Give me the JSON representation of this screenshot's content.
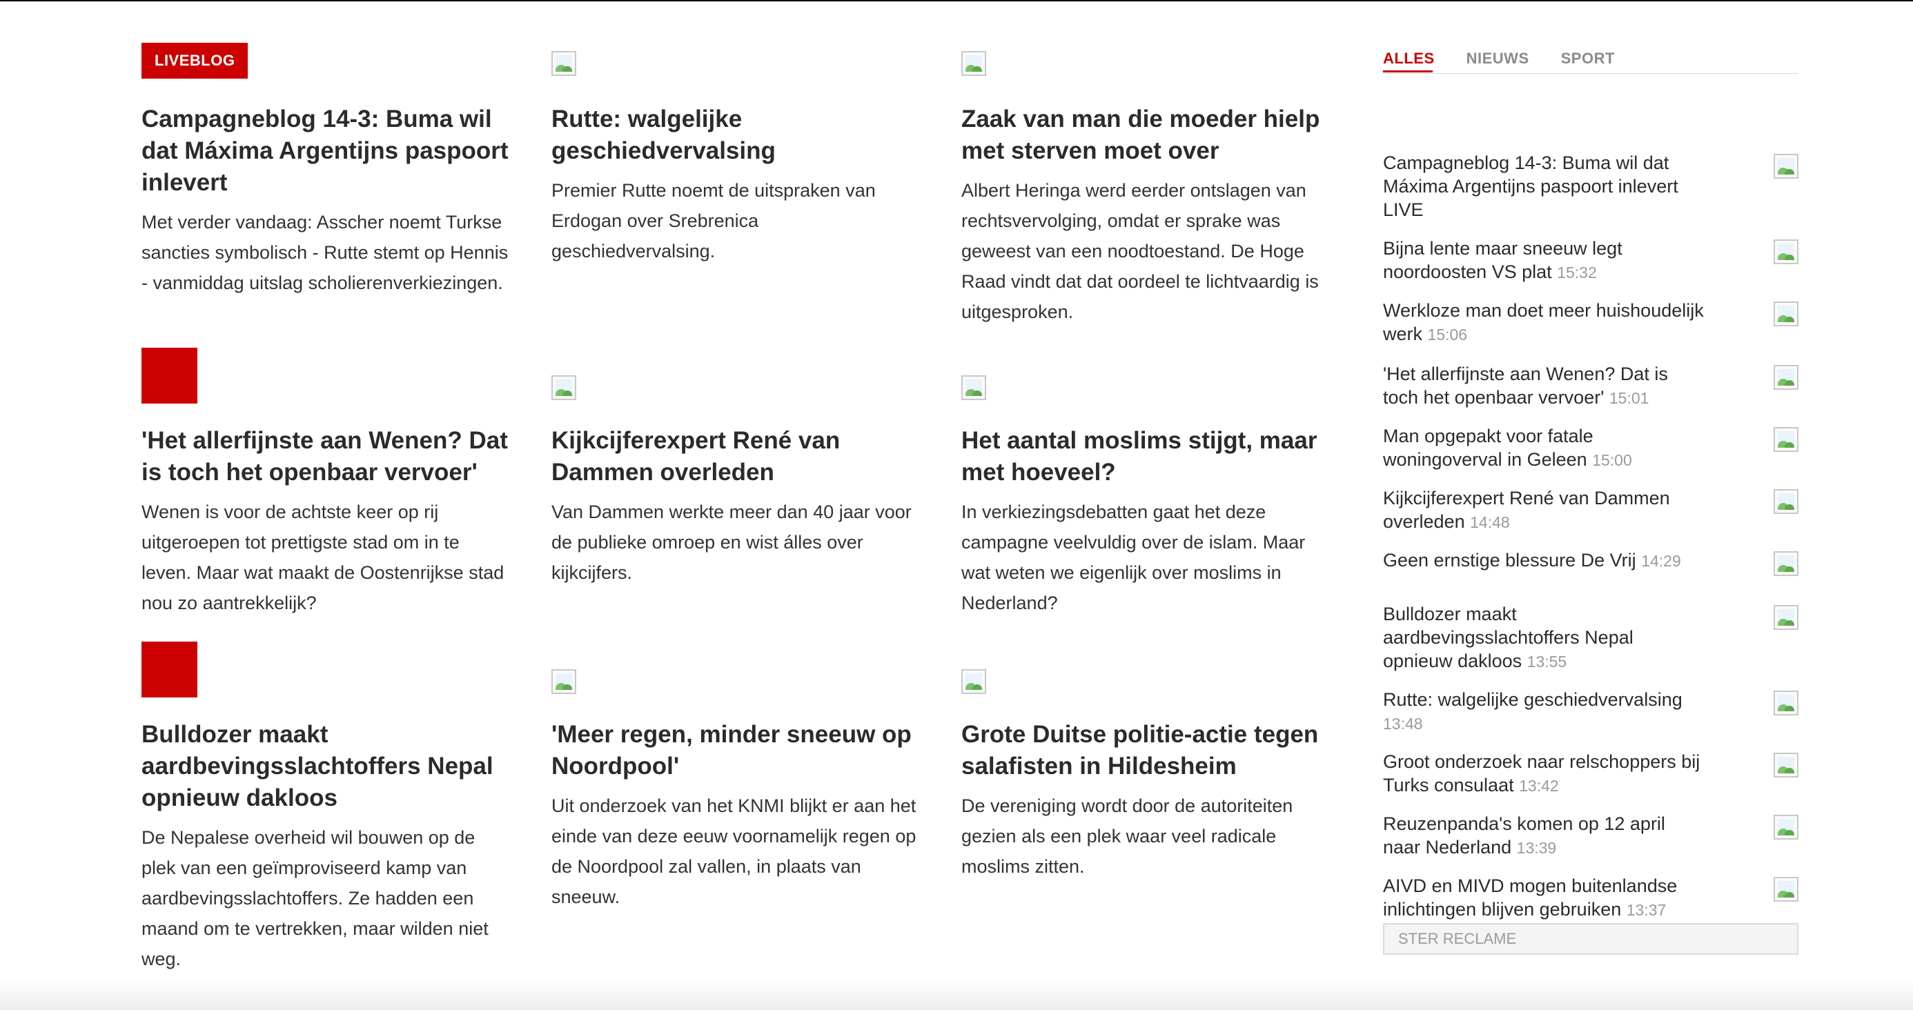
{
  "badge": {
    "label": "LIVEBLOG"
  },
  "articles": [
    {
      "title": "Campagneblog 14-3: Buma wil dat Máxima Argentijns paspoort inlevert",
      "excerpt": "Met verder vandaag: Asscher noemt Turkse sancties symbolisch - Rutte stemt op Hennis - vanmiddag uitslag scholierenverkiezingen."
    },
    {
      "title": "Rutte: walgelijke geschiedvervalsing",
      "excerpt": "Premier Rutte noemt de uitspraken van Erdogan over Srebrenica geschiedvervalsing."
    },
    {
      "title": "Zaak van man die moeder hielp met sterven moet over",
      "excerpt": "Albert Heringa werd eerder ontslagen van rechtsvervolging, omdat er sprake was geweest van een noodtoestand. De Hoge Raad vindt dat dat oordeel te lichtvaardig is uitgesproken."
    },
    {
      "title": "'Het allerfijnste aan Wenen? Dat is toch het openbaar vervoer'",
      "excerpt": "Wenen is voor de achtste keer op rij uitgeroepen tot prettigste stad om in te leven. Maar wat maakt de Oostenrijkse stad nou zo aantrekkelijk?"
    },
    {
      "title": "Kijkcijferexpert René van Dammen overleden",
      "excerpt": "Van Dammen werkte meer dan 40 jaar voor de publieke omroep en wist álles over kijkcijfers."
    },
    {
      "title": "Het aantal moslims stijgt, maar met hoeveel?",
      "excerpt": "In verkiezingsdebatten gaat het deze campagne veelvuldig over de islam. Maar wat weten we eigenlijk over moslims in Nederland?"
    },
    {
      "title": "Bulldozer maakt aardbevingsslachtoffers Nepal opnieuw dakloos",
      "excerpt": "De Nepalese overheid wil bouwen op de plek van een geïmproviseerd kamp van aardbevingsslachtoffers. Ze hadden een maand om te vertrekken, maar wilden niet weg."
    },
    {
      "title": "'Meer regen, minder sneeuw op Noordpool'",
      "excerpt": "Uit onderzoek van het KNMI blijkt er aan het einde van deze eeuw voornamelijk regen op de Noordpool zal vallen, in plaats van sneeuw."
    },
    {
      "title": "Grote Duitse politie-actie tegen salafisten in Hildesheim",
      "excerpt": "De vereniging wordt door de autoriteiten gezien als een plek waar veel radicale moslims zitten."
    }
  ],
  "sidebar": {
    "tabs": [
      "ALLES",
      "NIEUWS",
      "SPORT"
    ],
    "items": [
      {
        "title": "Campagneblog 14-3: Buma wil dat Máxima Argentijns paspoort inlevert",
        "time": "",
        "live": "LIVE"
      },
      {
        "title": "Bijna lente maar sneeuw legt noordoosten VS plat",
        "time": "15:32",
        "live": ""
      },
      {
        "title": "Werkloze man doet meer huishoudelijk werk",
        "time": "15:06",
        "live": ""
      },
      {
        "title": "'Het allerfijnste aan Wenen? Dat is toch het openbaar vervoer'",
        "time": "15:01",
        "live": ""
      },
      {
        "title": "Man opgepakt voor fatale woningoverval in Geleen",
        "time": "15:00",
        "live": ""
      },
      {
        "title": "Kijkcijferexpert René van Dammen overleden",
        "time": "14:48",
        "live": ""
      },
      {
        "title": "Geen ernstige blessure De Vrij",
        "time": "14:29",
        "live": ""
      },
      {
        "title": "Bulldozer maakt aardbevingsslachtoffers Nepal opnieuw dakloos",
        "time": "13:55",
        "live": ""
      },
      {
        "title": "Rutte: walgelijke geschiedvervalsing",
        "time": "13:48",
        "live": ""
      },
      {
        "title": "Groot onderzoek naar relschoppers bij Turks consulaat",
        "time": "13:42",
        "live": ""
      },
      {
        "title": "Reuzenpanda's komen op 12 april naar Nederland",
        "time": "13:39",
        "live": ""
      },
      {
        "title": "AIVD en MIVD mogen buitenlandse inlichtingen blijven gebruiken",
        "time": "13:37",
        "live": ""
      }
    ],
    "ster_label": "STER RECLAME"
  }
}
